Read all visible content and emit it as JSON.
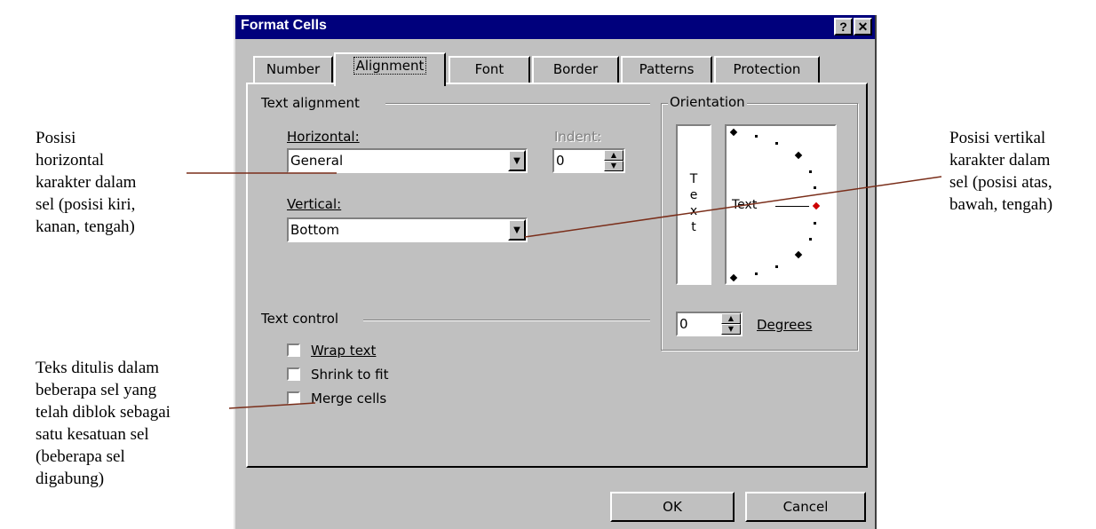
{
  "annotations": {
    "horizontal": [
      "Posisi",
      "horizontal",
      "karakter dalam",
      "sel (posisi kiri,",
      "kanan, tengah)"
    ],
    "vertical": [
      "Posisi vertikal",
      "karakter dalam",
      "sel (posisi atas,",
      "bawah, tengah)"
    ],
    "merge": [
      "Teks ditulis dalam",
      "beberapa sel yang",
      "telah diblok sebagai",
      "satu kesatuan sel",
      "(beberapa sel",
      "digabung)"
    ],
    "line_color": "#7a2e1a"
  },
  "dialog": {
    "title": "Format Cells",
    "help_label": "?",
    "close_label": "✕",
    "tabs": [
      "Number",
      "Alignment",
      "Font",
      "Border",
      "Patterns",
      "Protection"
    ],
    "active_tab": "Alignment",
    "text_alignment": {
      "legend": "Text alignment",
      "horizontal_label": "Horizontal:",
      "horizontal_value": "General",
      "indent_label": "Indent:",
      "indent_value": "0",
      "vertical_label": "Vertical:",
      "vertical_value": "Bottom"
    },
    "orientation": {
      "legend": "Orientation",
      "vertical_text": [
        "T",
        "e",
        "x",
        "t"
      ],
      "dial_text": "Text",
      "degrees_value": "0",
      "degrees_label": "Degrees"
    },
    "text_control": {
      "legend": "Text control",
      "options": [
        {
          "label": "Wrap text",
          "checked": false
        },
        {
          "label": "Shrink to fit",
          "checked": false
        },
        {
          "label": "Merge cells",
          "checked": false
        }
      ]
    },
    "ok_label": "OK",
    "cancel_label": "Cancel",
    "colors": {
      "title_bar": "#00007c",
      "face": "#c0c0c0",
      "pointer": "#cc0000"
    }
  }
}
